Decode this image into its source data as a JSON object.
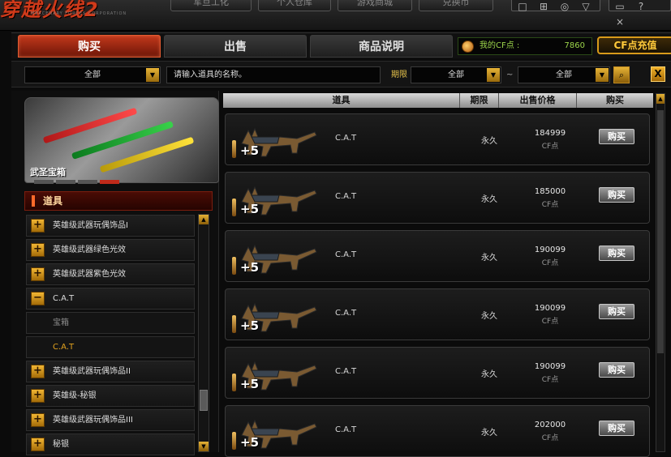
{
  "top": {
    "logo_text": "穿越火线2",
    "logo_sub": "MERCENARY FORCES CORPORATION",
    "nav": [
      "军旦工化",
      "个人仓库",
      "游戏商城",
      "兑换币"
    ],
    "window_controls": [
      "□",
      "⊞",
      "◎",
      "▽",
      "▭",
      "?",
      "×"
    ]
  },
  "tabs": {
    "buy": "购买",
    "sell": "出售",
    "description": "商品说明"
  },
  "cf_points": {
    "label": "我的CF点 :",
    "value": "7860"
  },
  "recharge_label": "CF点充值",
  "filter": {
    "category_value": "全部",
    "search_placeholder": "请输入道具的名称。",
    "term_label": "期限",
    "from_value": "全部",
    "tilde": "~",
    "to_value": "全部",
    "close_label": "X"
  },
  "sidebar": {
    "promo_title": "武圣宝箱",
    "category_header": "道具",
    "items": [
      {
        "label": "英雄级武器玩偶饰品I",
        "type": "group",
        "toggle": "+"
      },
      {
        "label": "英雄级武器绿色光效",
        "type": "group",
        "toggle": "+"
      },
      {
        "label": "英雄级武器紫色光效",
        "type": "group",
        "toggle": "+"
      },
      {
        "label": "C.A.T",
        "type": "group",
        "toggle": "−"
      },
      {
        "label": "宝箱",
        "type": "sub"
      },
      {
        "label": "C.A.T",
        "type": "sub-selected"
      },
      {
        "label": "英雄级武器玩偶饰品II",
        "type": "group",
        "toggle": "+"
      },
      {
        "label": "英雄级-秘银",
        "type": "group",
        "toggle": "+"
      },
      {
        "label": "英雄级武器玩偶饰品III",
        "type": "group",
        "toggle": "+"
      },
      {
        "label": "秘银",
        "type": "group",
        "toggle": "+"
      }
    ]
  },
  "table": {
    "headers": {
      "item": "道具",
      "term": "期限",
      "price": "出售价格",
      "buy": "购买"
    },
    "rows": [
      {
        "name": "C.A.T",
        "quantity": "+5",
        "term": "永久",
        "price": "184999",
        "unit": "CF点",
        "buy_label": "购买"
      },
      {
        "name": "C.A.T",
        "quantity": "+5",
        "term": "永久",
        "price": "185000",
        "unit": "CF点",
        "buy_label": "购买"
      },
      {
        "name": "C.A.T",
        "quantity": "+5",
        "term": "永久",
        "price": "190099",
        "unit": "CF点",
        "buy_label": "购买"
      },
      {
        "name": "C.A.T",
        "quantity": "+5",
        "term": "永久",
        "price": "190099",
        "unit": "CF点",
        "buy_label": "购买"
      },
      {
        "name": "C.A.T",
        "quantity": "+5",
        "term": "永久",
        "price": "190099",
        "unit": "CF点",
        "buy_label": "购买"
      },
      {
        "name": "C.A.T",
        "quantity": "+5",
        "term": "永久",
        "price": "202000",
        "unit": "CF点",
        "buy_label": "购买"
      }
    ]
  },
  "colors": {
    "accent_red": "#c2381b",
    "gold": "#e6b336",
    "points_green": "#9bd34a"
  }
}
